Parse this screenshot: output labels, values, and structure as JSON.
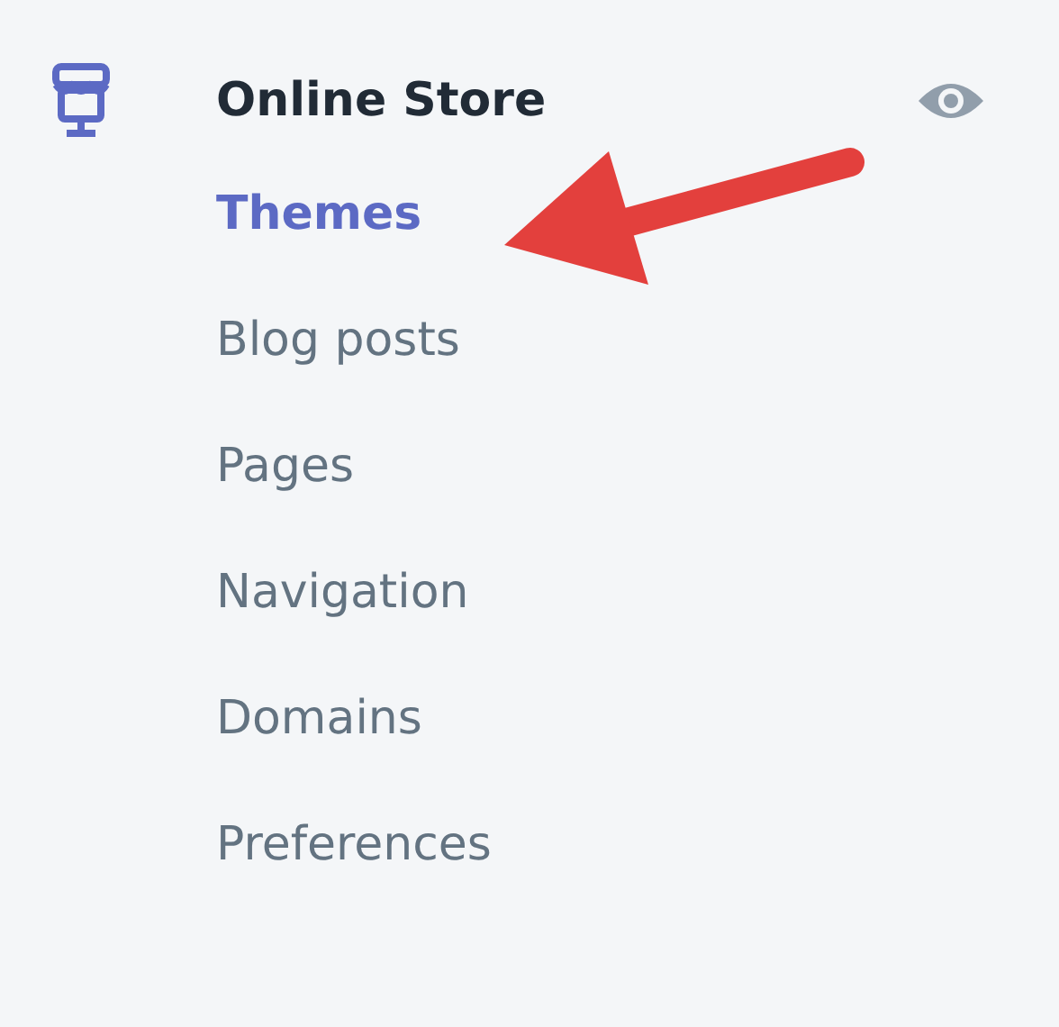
{
  "section": {
    "title": "Online Store",
    "visible": true
  },
  "items": [
    {
      "label": "Themes",
      "selected": true
    },
    {
      "label": "Blog posts",
      "selected": false
    },
    {
      "label": "Pages",
      "selected": false
    },
    {
      "label": "Navigation",
      "selected": false
    },
    {
      "label": "Domains",
      "selected": false
    },
    {
      "label": "Preferences",
      "selected": false
    }
  ]
}
